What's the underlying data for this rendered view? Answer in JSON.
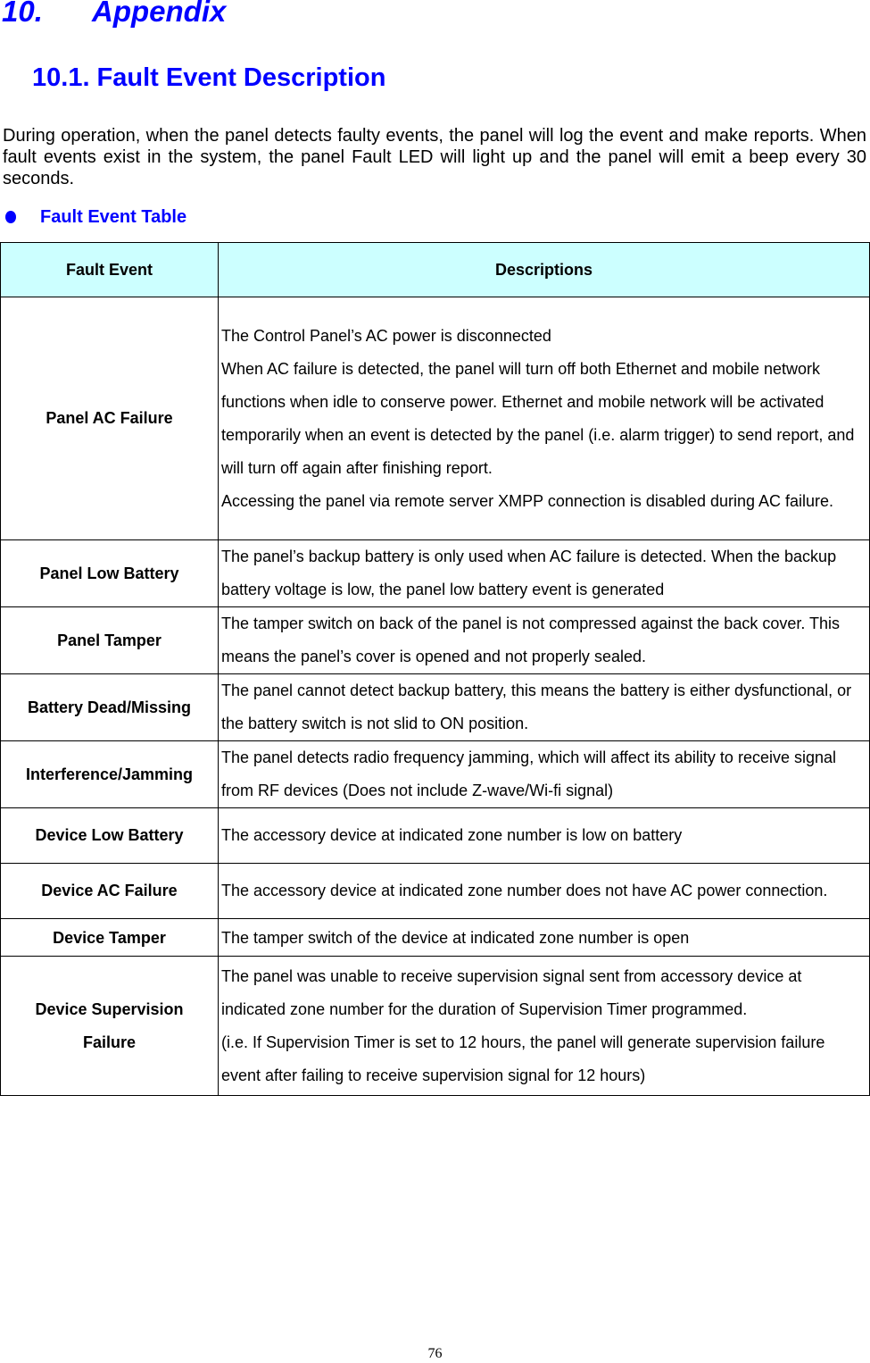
{
  "chapter": {
    "number": "10.",
    "title": "Appendix"
  },
  "section": {
    "title": "10.1. Fault Event Description"
  },
  "intro_paragraph": "During operation, when the panel detects faulty events, the panel will log the event and make reports. When fault events exist in the system, the panel Fault LED will light up and the panel will emit a beep every 30 seconds.",
  "bullet": {
    "icon": "bullet-dot-icon",
    "label": "Fault Event Table"
  },
  "colors": {
    "heading": "#0000ff",
    "table_header_bg": "#ccffff"
  },
  "table": {
    "headers": [
      "Fault Event",
      "Descriptions"
    ],
    "rows": [
      {
        "event": "Panel AC Failure",
        "lines": [
          "The Control Panel’s AC power is disconnected",
          "When AC failure is detected, the panel will turn off both Ethernet and mobile network functions when idle to conserve power. Ethernet and mobile network will be activated temporarily when an event is detected by the panel (i.e. alarm trigger) to send report, and will turn off again after finishing report.",
          "Accessing the panel via remote server XMPP connection is disabled during AC failure."
        ]
      },
      {
        "event": "Panel Low Battery",
        "lines": [
          "The panel’s backup battery is only used when AC failure is detected. When the backup battery voltage is low, the panel low battery event is generated"
        ]
      },
      {
        "event": "Panel Tamper",
        "lines": [
          "The tamper switch on back of the panel is not compressed against the back cover. This means the panel’s cover is opened and not properly sealed."
        ]
      },
      {
        "event": "Battery Dead/Missing",
        "lines": [
          "The panel cannot detect backup battery, this means the battery is either dysfunctional, or the battery switch is not slid to ON position."
        ]
      },
      {
        "event": "Interference/Jamming",
        "lines": [
          "The panel detects radio frequency jamming, which will affect its ability to receive signal from RF devices (Does not include Z-wave/Wi-fi signal)"
        ]
      },
      {
        "event": "Device Low Battery",
        "lines": [
          "The accessory device at indicated zone number is low on battery"
        ]
      },
      {
        "event": "Device AC Failure",
        "lines": [
          "The accessory device at indicated zone number does not have AC power connection."
        ]
      },
      {
        "event": "Device Tamper",
        "lines": [
          "The tamper switch of the device at indicated zone number is open"
        ]
      },
      {
        "event": "Device Supervision Failure",
        "lines": [
          "The panel was unable to receive supervision signal sent from accessory device at indicated zone number for the duration of Supervision Timer programmed.",
          "(i.e. If Supervision Timer is set to 12 hours, the panel will generate supervision failure event after failing to receive supervision signal for 12 hours)"
        ]
      }
    ]
  },
  "page_number": "76"
}
